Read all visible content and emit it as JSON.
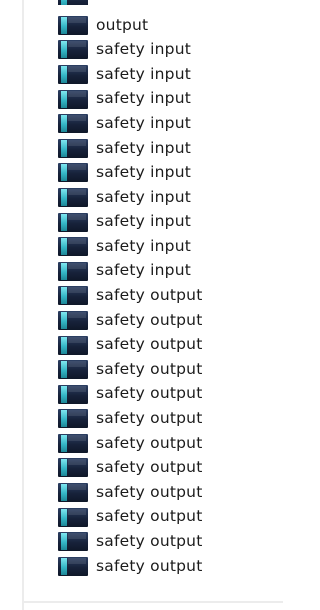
{
  "icon": "module-icon",
  "colors": {
    "icon_body": "#17223a",
    "icon_stripe": "#34b6c6",
    "text": "#1b1b1b"
  },
  "items": [
    {
      "label": "output"
    },
    {
      "label": "safety input"
    },
    {
      "label": "safety input"
    },
    {
      "label": "safety input"
    },
    {
      "label": "safety input"
    },
    {
      "label": "safety input"
    },
    {
      "label": "safety input"
    },
    {
      "label": "safety input"
    },
    {
      "label": "safety input"
    },
    {
      "label": "safety input"
    },
    {
      "label": "safety input"
    },
    {
      "label": "safety output"
    },
    {
      "label": "safety output"
    },
    {
      "label": "safety output"
    },
    {
      "label": "safety output"
    },
    {
      "label": "safety output"
    },
    {
      "label": "safety output"
    },
    {
      "label": "safety output"
    },
    {
      "label": "safety output"
    },
    {
      "label": "safety output"
    },
    {
      "label": "safety output"
    },
    {
      "label": "safety output"
    },
    {
      "label": "safety output"
    }
  ]
}
